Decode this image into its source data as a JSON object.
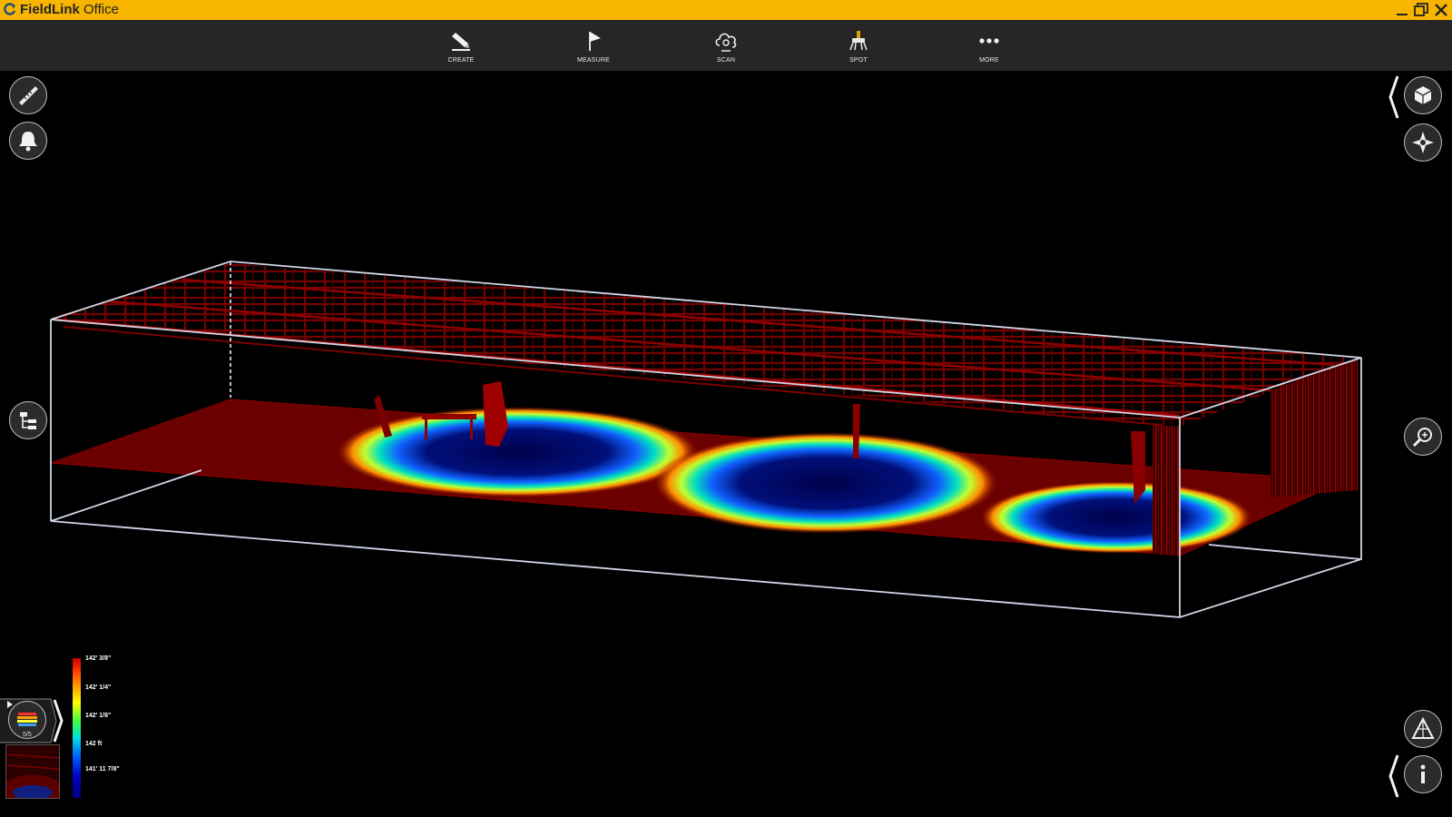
{
  "app": {
    "title_bold": "FieldLink",
    "title_rest": " Office"
  },
  "toolbar": {
    "items": [
      {
        "label": "CREATE",
        "icon": "pencil-icon"
      },
      {
        "label": "MEASURE",
        "icon": "flag-icon"
      },
      {
        "label": "SCAN",
        "icon": "scan-cloud-icon"
      },
      {
        "label": "SPOT",
        "icon": "spot-device-icon"
      },
      {
        "label": "MORE",
        "icon": "more-dots-icon"
      }
    ]
  },
  "left_tools": [
    {
      "icon": "ruler-icon"
    },
    {
      "icon": "bell-icon"
    },
    {
      "icon": "tree-hierarchy-icon"
    }
  ],
  "right_tools": [
    {
      "icon": "cube-view-icon"
    },
    {
      "icon": "navigation-compass-icon"
    },
    {
      "icon": "zoom-fit-icon"
    },
    {
      "icon": "triangle-surface-icon"
    },
    {
      "icon": "info-icon"
    }
  ],
  "layer_panel": {
    "badge": "5/5",
    "icon": "color-layers-icon"
  },
  "legend": {
    "labels": [
      "142' 3/8\"",
      "142' 1/4\"",
      "142' 1/8\"",
      "142 ft",
      "141' 11 7/8\""
    ]
  },
  "colors": {
    "titlebar": "#f7b500",
    "toolbar": "#262626",
    "point_cloud_red": "#8a0000",
    "bbox_line": "#cfd8e8"
  }
}
